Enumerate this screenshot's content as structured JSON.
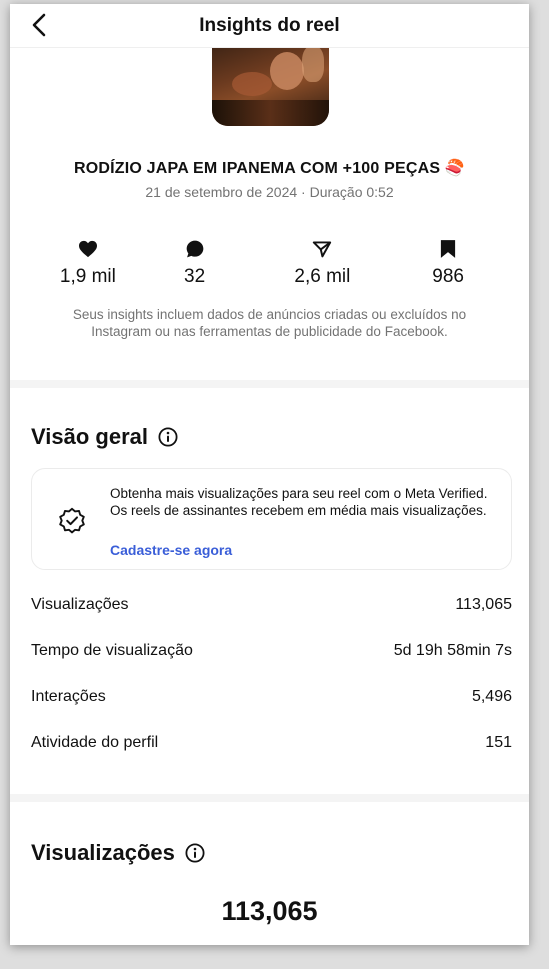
{
  "header": {
    "title": "Insights do reel",
    "back_icon": "chevron-left-icon"
  },
  "reel": {
    "title": "RODÍZIO JAPA EM IPANEMA COM +100 PEÇAS 🍣",
    "meta": "21 de setembro de 2024 · Duração 0:52"
  },
  "stats": [
    {
      "icon": "heart-icon",
      "value": "1,9 mil"
    },
    {
      "icon": "comment-icon",
      "value": "32"
    },
    {
      "icon": "send-icon",
      "value": "2,6 mil"
    },
    {
      "icon": "bookmark-icon",
      "value": "986"
    }
  ],
  "disclaimer": "Seus insights incluem dados de anúncios criadas ou excluídos no Instagram ou nas ferramentas de publicidade do Facebook.",
  "overview": {
    "title": "Visão geral",
    "promo_text": "Obtenha mais visualizações para seu reel com o Meta Verified. Os reels de assinantes recebem em média mais visualizações.",
    "promo_link": "Cadastre-se agora",
    "rows": [
      {
        "label": "Visualizações",
        "value": "113,065"
      },
      {
        "label": "Tempo de visualização",
        "value": "5d 19h 58min 7s"
      },
      {
        "label": "Interações",
        "value": "5,496"
      },
      {
        "label": "Atividade do perfil",
        "value": "151"
      }
    ]
  },
  "views_section": {
    "title": "Visualizações",
    "total": "113,065"
  },
  "colors": {
    "link": "#3a5ed8",
    "muted": "#737373",
    "divider": "#f4f4f4"
  }
}
